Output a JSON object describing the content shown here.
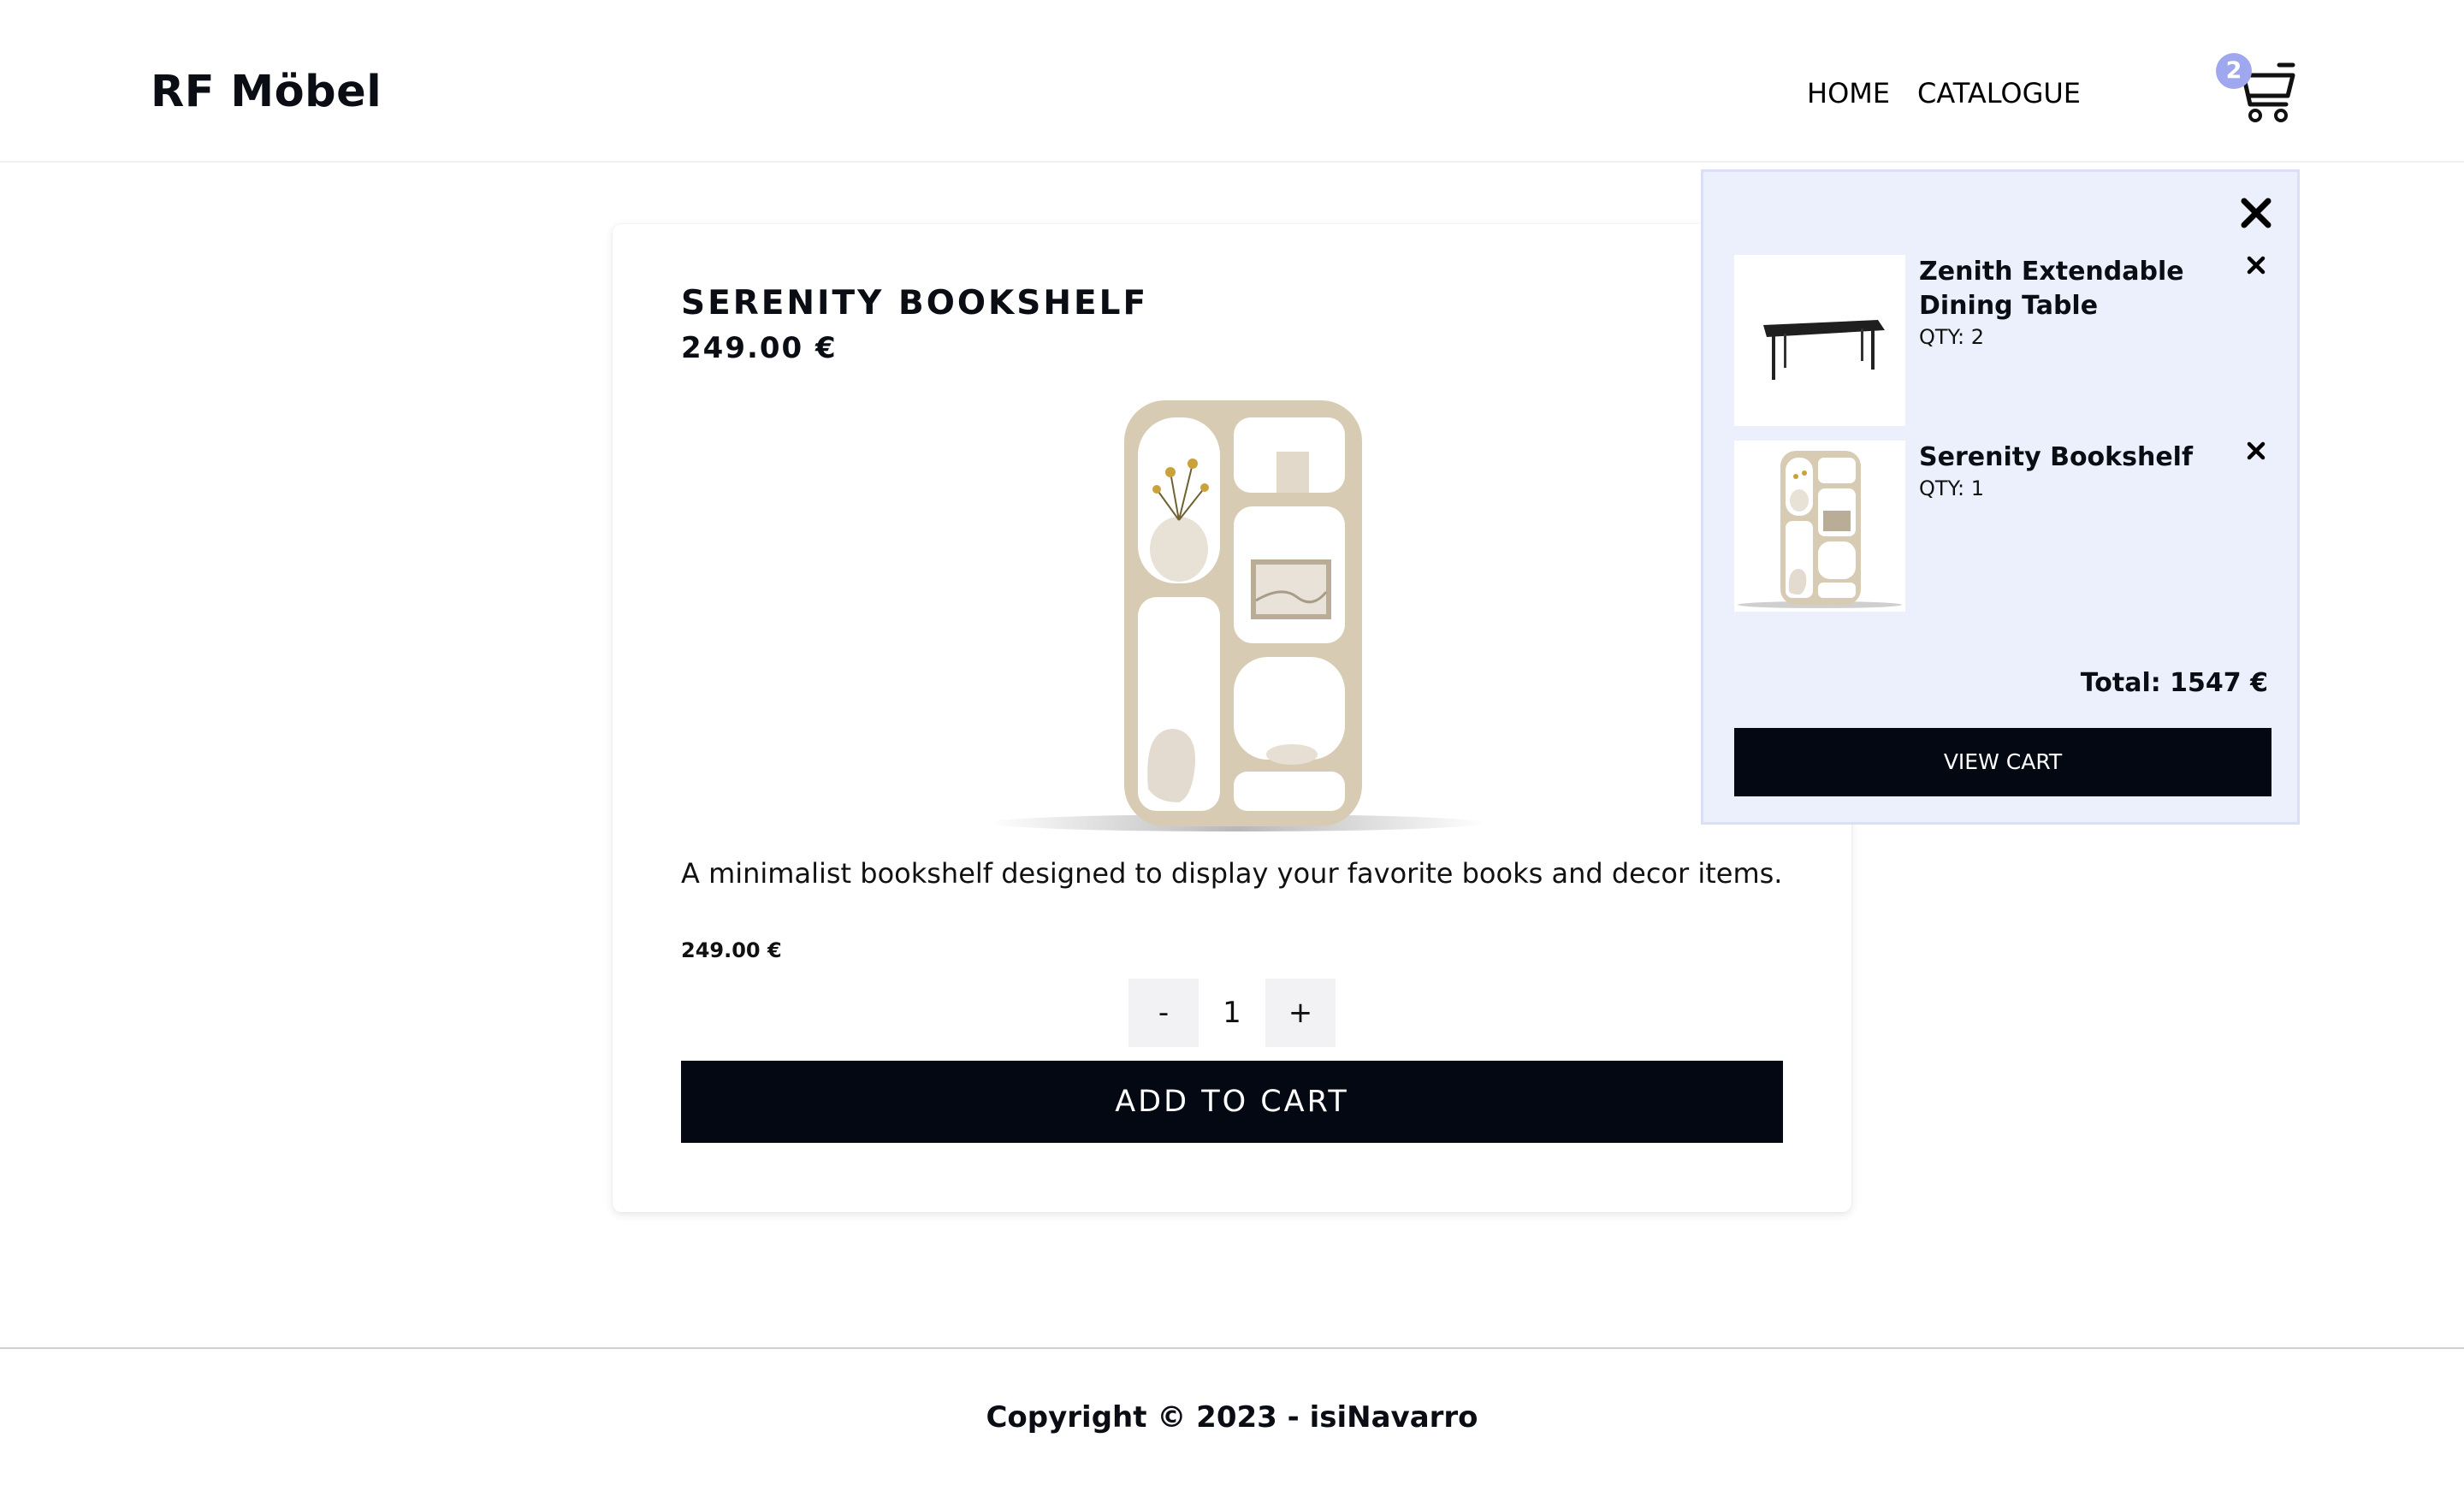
{
  "header": {
    "logo": "RF Möbel",
    "nav": {
      "home": "HOME",
      "catalogue": "CATALOGUE"
    },
    "cart_count": "2",
    "cart_icon": "cart-icon"
  },
  "product": {
    "title": "SERENITY BOOKSHELF",
    "price": "249.00 €",
    "description": "A minimalist bookshelf designed to display your favorite books and decor items.",
    "price_small": "249.00 €",
    "quantity": {
      "minus": "-",
      "value": "1",
      "plus": "+"
    },
    "add_to_cart": "ADD TO CART"
  },
  "minicart": {
    "close_icon": "close-icon",
    "items": [
      {
        "name": "Zenith Extendable Dining Table",
        "qty": "QTY: 2"
      },
      {
        "name": "Serenity Bookshelf",
        "qty": "QTY: 1"
      }
    ],
    "total": "Total: 1547 €",
    "view_cart": "VIEW CART"
  },
  "footer": {
    "copyright": "Copyright © 2023 - isiNavarro"
  },
  "colors": {
    "dark": "#040812",
    "minicart_bg": "#ecf0fc",
    "badge": "#9fa7ee"
  }
}
